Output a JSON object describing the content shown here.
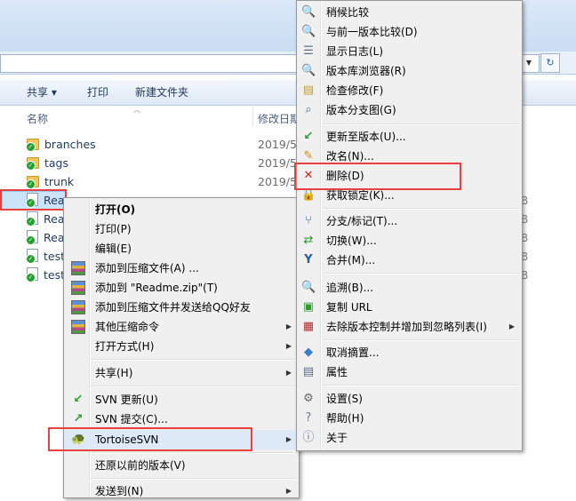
{
  "explorer": {
    "toolbar": {
      "share": "共享 ▾",
      "print": "打印",
      "new_folder": "新建文件夹"
    },
    "columns": {
      "name": "名称",
      "modified": "修改日期"
    },
    "files": [
      {
        "name": "branches",
        "date": "2019/5",
        "type": "folder"
      },
      {
        "name": "tags",
        "date": "2019/5",
        "type": "folder"
      },
      {
        "name": "trunk",
        "date": "2019/5",
        "type": "folder"
      },
      {
        "name": "Rea",
        "date": "",
        "type": "file",
        "size": "B"
      },
      {
        "name": "Rea",
        "date": "",
        "type": "file",
        "size": "B"
      },
      {
        "name": "Rea",
        "date": "",
        "type": "file",
        "size": "B"
      },
      {
        "name": "test",
        "date": "",
        "type": "file",
        "size": "B"
      },
      {
        "name": "test",
        "date": "",
        "type": "file",
        "size": "B"
      }
    ]
  },
  "context_menu": {
    "items": [
      {
        "label": "打开(O)",
        "bold": true
      },
      {
        "label": "打印(P)"
      },
      {
        "label": "编辑(E)"
      },
      {
        "label": "添加到压缩文件(A) ..."
      },
      {
        "label": "添加到 \"Readme.zip\"(T)"
      },
      {
        "label": "添加到压缩文件并发送给QQ好友"
      },
      {
        "label": "其他压缩命令"
      },
      {
        "label": "打开方式(H)"
      },
      {
        "label": "共享(H)"
      },
      {
        "label": "SVN 更新(U)"
      },
      {
        "label": "SVN 提交(C)..."
      },
      {
        "label": "TortoiseSVN"
      },
      {
        "label": "还原以前的版本(V)"
      },
      {
        "label": "发送到(N)"
      }
    ]
  },
  "svn_submenu": {
    "items": [
      {
        "label": "稍候比较",
        "icon": "magnifier-icon"
      },
      {
        "label": "与前一版本比较(D)",
        "icon": "compare-icon"
      },
      {
        "label": "显示日志(L)",
        "icon": "log-icon"
      },
      {
        "label": "版本库浏览器(R)",
        "icon": "repo-browser-icon"
      },
      {
        "label": "检查修改(F)",
        "icon": "check-modifications-icon"
      },
      {
        "label": "版本分支图(G)",
        "icon": "revision-graph-icon"
      },
      {
        "label": "更新至版本(U)...",
        "icon": "update-icon"
      },
      {
        "label": "改名(N)...",
        "icon": "rename-icon"
      },
      {
        "label": "删除(D)",
        "icon": "delete-icon"
      },
      {
        "label": "获取锁定(K)...",
        "icon": "lock-icon"
      },
      {
        "label": "分支/标记(T)...",
        "icon": "branch-icon"
      },
      {
        "label": "切换(W)...",
        "icon": "switch-icon"
      },
      {
        "label": "合并(M)...",
        "icon": "merge-icon"
      },
      {
        "label": "追溯(B)...",
        "icon": "blame-icon"
      },
      {
        "label": "复制 URL",
        "icon": "copy-url-icon"
      },
      {
        "label": "去除版本控制并增加到忽略列表(I)",
        "icon": "ignore-icon"
      },
      {
        "label": "取消摘置...",
        "icon": "revert-icon"
      },
      {
        "label": "属性",
        "icon": "properties-icon"
      },
      {
        "label": "设置(S)",
        "icon": "settings-icon"
      },
      {
        "label": "帮助(H)",
        "icon": "help-icon"
      },
      {
        "label": "关于",
        "icon": "about-icon"
      }
    ]
  },
  "colors": {
    "highlight": "#e8413e",
    "svn_ok": "#23a02d"
  }
}
